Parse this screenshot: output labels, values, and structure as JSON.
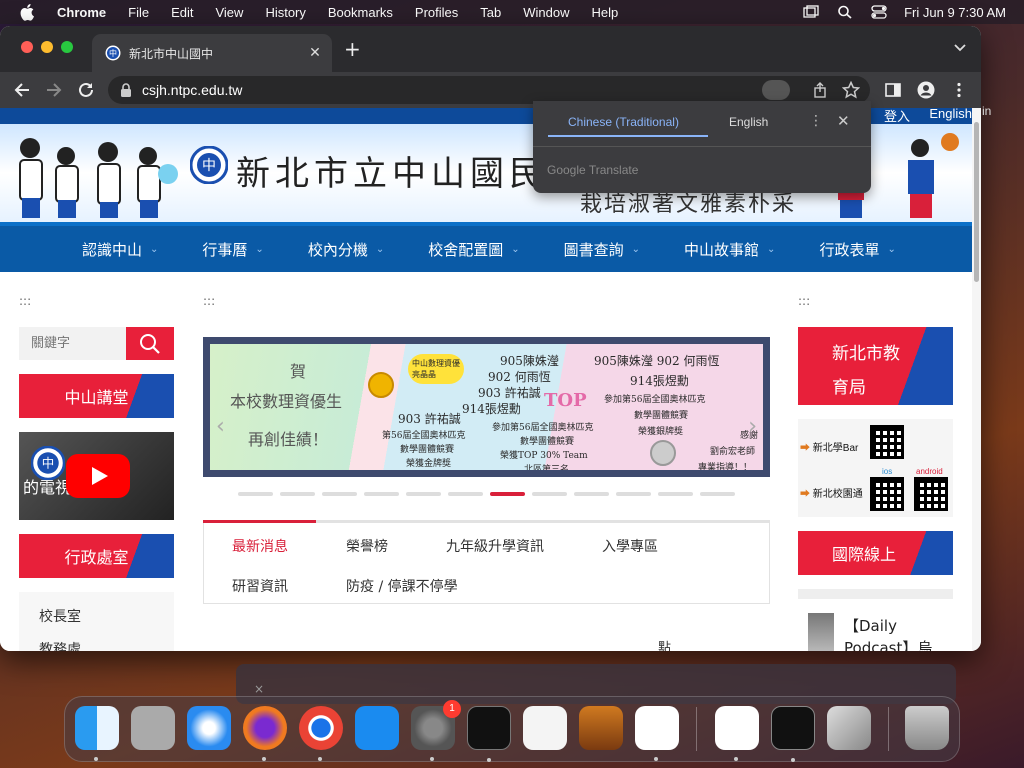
{
  "menubar": {
    "app_name": "Chrome",
    "items": [
      "File",
      "Edit",
      "View",
      "History",
      "Bookmarks",
      "Profiles",
      "Tab",
      "Window",
      "Help"
    ],
    "clock": "Fri Jun 9  7:30 AM"
  },
  "browser": {
    "tab_title": "新北市中山國中",
    "url": "csjh.ntpc.edu.tw",
    "new_tab_label": "+"
  },
  "translate_popup": {
    "source_lang": "Chinese (Traditional)",
    "target_lang": "English",
    "brand": "Google Translate"
  },
  "site": {
    "top_links": {
      "login": "登入",
      "english": "English"
    },
    "banner_title": "新北市立中山國民中",
    "banner_sub": "栽培淑著文雅素朴采",
    "nav": [
      {
        "label": "認識中山"
      },
      {
        "label": "行事曆"
      },
      {
        "label": "校內分機"
      },
      {
        "label": "校舍配置圖"
      },
      {
        "label": "圖書查詢"
      },
      {
        "label": "中山故事館"
      },
      {
        "label": "行政表單"
      }
    ],
    "placeholder_dots": ":::",
    "search_placeholder": "關鍵字",
    "left_sections": {
      "lecture": "中山講堂",
      "video_text": "的電視國日常",
      "admin": "行政處室",
      "offices": [
        "校長室",
        "教務處"
      ]
    },
    "slide": {
      "congrats": "賀",
      "headline1": "本校數理資優生",
      "headline2": "再創佳績！",
      "badge": "中山數理資優 亮晶晶",
      "t1": "905陳姝瀅",
      "t2": "902 何雨恆",
      "t3": "903 許祐誠",
      "t4": "914張煜勳",
      "t5": "903 許祐誠",
      "t6": "第56屆全國奧林匹克",
      "t7": "數學團體競賽",
      "t8": "榮獲金牌獎",
      "t9": "參加第56屆全國奧林匹克",
      "t10": "數學團體競賽",
      "t11": "榮獲TOP 30% Team",
      "t12": "北區第三名",
      "t13": "905陳姝瀅 902 何雨恆",
      "t14": "914張煜勳",
      "t15": "參加第56屆全國奧林匹克",
      "t16": "數學團體競賽",
      "t17": "榮獲銀牌獎",
      "t18": "感謝",
      "t19": "劉俞宏老師",
      "t20": "專業指導！！",
      "top_word": "TOP"
    },
    "slide_count": 12,
    "slide_active": 6,
    "news_tabs": [
      "最新消息",
      "榮譽榜",
      "九年級升學資訊",
      "入學專區",
      "研習資訊",
      "防疫 / 停課不停學"
    ],
    "news_dian": "點",
    "right_sections": {
      "edu_bureau_line1": "新北市教",
      "edu_bureau_line2": "育局",
      "qr_label1": "新北學Bar",
      "qr_label2": "新北校園通",
      "ios": "ios",
      "android": "android",
      "intl": "國際線上",
      "podcast": "【Daily Podcast】烏"
    }
  },
  "desktop": {
    "edge_text": "in",
    "bgwin_close": "×"
  },
  "dock": {
    "apps": [
      "finder",
      "launchpad",
      "safari",
      "firefox",
      "chrome",
      "app-store",
      "system-preferences",
      "terminal",
      "textedit",
      "garageband",
      "vscode",
      "visual-studio",
      "activity-monitor",
      "transmit",
      "trash"
    ],
    "badge_count": "1"
  },
  "colors": {
    "site_red": "#e8203a",
    "site_blue": "#0a5aa6",
    "chrome_dark": "#3c3c3f"
  }
}
